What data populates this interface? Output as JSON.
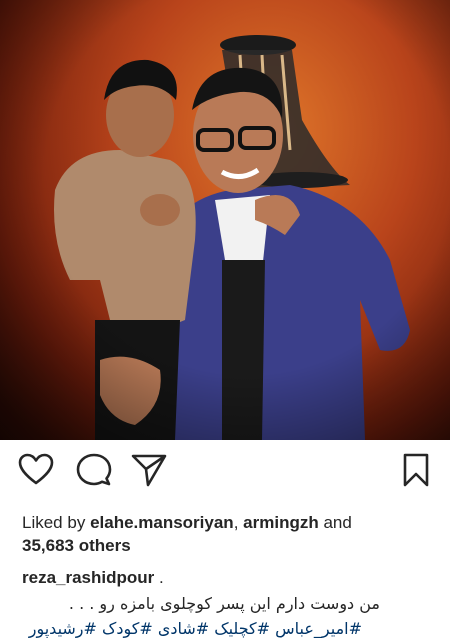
{
  "post": {
    "image_alt": "",
    "likes": {
      "prefix": "Liked by",
      "user1": "elahe.mansoriyan",
      "separator": ",",
      "user2": "armingzh",
      "conjunction": "and",
      "count_text": "35,683 others"
    },
    "caption": {
      "username": "reza_rashidpour",
      "username_suffix": ".",
      "text": "من دوست دارم این پسر کوچلوی بامزه رو . . .",
      "hashtags": "#امیر_عباس #کچلیک #شادی #کودک #رشیدپور"
    }
  },
  "icons": {
    "like": "heart-outline-icon",
    "comment": "speech-bubble-icon",
    "share": "paper-plane-icon",
    "save": "bookmark-icon"
  },
  "colors": {
    "text": "#262626",
    "hashtag": "#003569",
    "photo_background": "#b9441b"
  }
}
